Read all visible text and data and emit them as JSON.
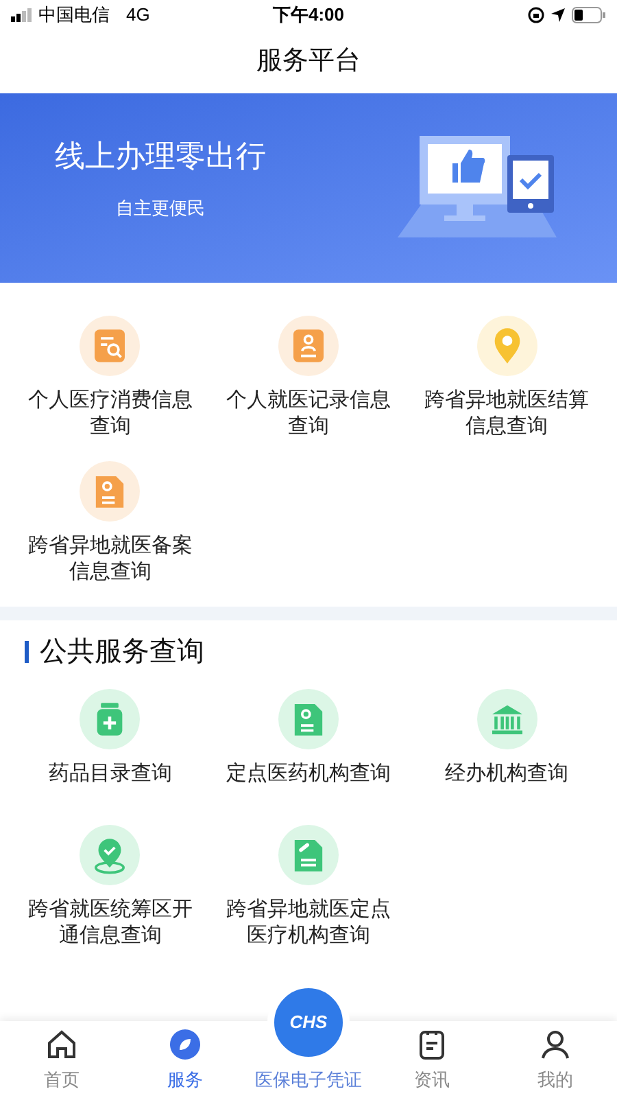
{
  "status_bar": {
    "carrier": "中国电信",
    "network": "4G",
    "time": "下午4:00"
  },
  "window": {
    "title": "服务平台"
  },
  "banner": {
    "headline": "线上办理零出行",
    "subtitle": "自主更便民"
  },
  "personal_services": [
    {
      "label": "个人医疗消费信息查询",
      "kind": "search-doc",
      "color": "#f5a04a"
    },
    {
      "label": "个人就医记录信息查询",
      "kind": "person-doc",
      "color": "#f5a04a"
    },
    {
      "label": "跨省异地就医结算信息查询",
      "kind": "pin",
      "color": "#f7c232"
    },
    {
      "label": "跨省异地就医备案信息查询",
      "kind": "pin-doc",
      "color": "#f5a04a"
    }
  ],
  "public_services": {
    "title": "公共服务查询",
    "items": [
      {
        "label": "药品目录查询",
        "kind": "medicine"
      },
      {
        "label": "定点医药机构查询",
        "kind": "pin-doc"
      },
      {
        "label": "经办机构查询",
        "kind": "bank"
      },
      {
        "label": "跨省就医统筹区开通信息查询",
        "kind": "pin-check"
      },
      {
        "label": "跨省异地就医定点医疗机构查询",
        "kind": "pill-doc"
      }
    ]
  },
  "bottom_nav": [
    {
      "label": "首页",
      "kind": "home",
      "selected": false
    },
    {
      "label": "服务",
      "kind": "service",
      "selected": true
    },
    {
      "label": "医保电子凭证",
      "kind": "center",
      "badge": "CHS",
      "selected": false
    },
    {
      "label": "资讯",
      "kind": "news",
      "selected": false
    },
    {
      "label": "我的",
      "kind": "profile",
      "selected": false
    }
  ]
}
